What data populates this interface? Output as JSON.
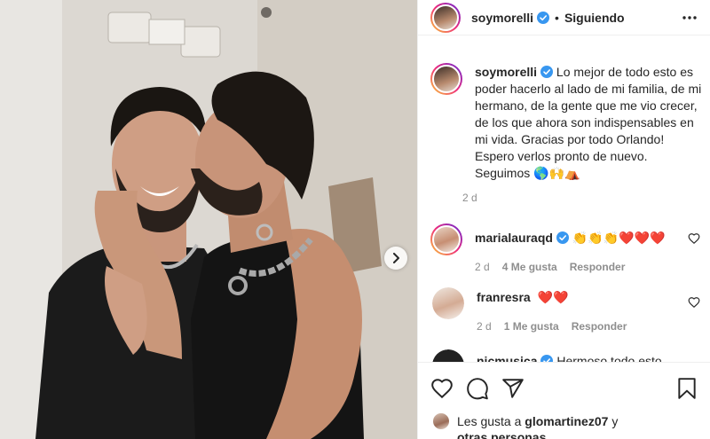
{
  "header": {
    "username": "soymorelli",
    "separator": "•",
    "follow_status": "Siguiendo",
    "more_icon": "more-horizontal-icon"
  },
  "caption": {
    "username": "soymorelli",
    "text": "Lo mejor de todo esto es poder hacerlo al lado de mi familia, de mi hermano, de la gente que me vio crecer, de los que ahora son indispensables en mi vida. Gracias por todo Orlando! Espero verlos pronto de nuevo. Seguimos 🌎🙌⛺",
    "time": "2 d"
  },
  "comments": [
    {
      "username": "marialauraqd",
      "verified": true,
      "text": "👏👏👏❤️❤️❤️",
      "time": "2 d",
      "likes": "4 Me gusta",
      "reply": "Responder"
    },
    {
      "username": "franresra",
      "verified": false,
      "text": "❤️❤️",
      "time": "2 d",
      "likes": "1 Me gusta",
      "reply": "Responder"
    },
    {
      "username": "nicmusica",
      "verified": true,
      "text": "Hermoso todo esto",
      "time": "",
      "likes": "",
      "reply": ""
    }
  ],
  "likes": {
    "prefix": "Les gusta a",
    "user": "glomartinez07",
    "and": "y",
    "others": "otras personas"
  },
  "colors": {
    "verified": "#3897f0",
    "meta_text": "#8e8e8e",
    "border": "#efefef"
  }
}
